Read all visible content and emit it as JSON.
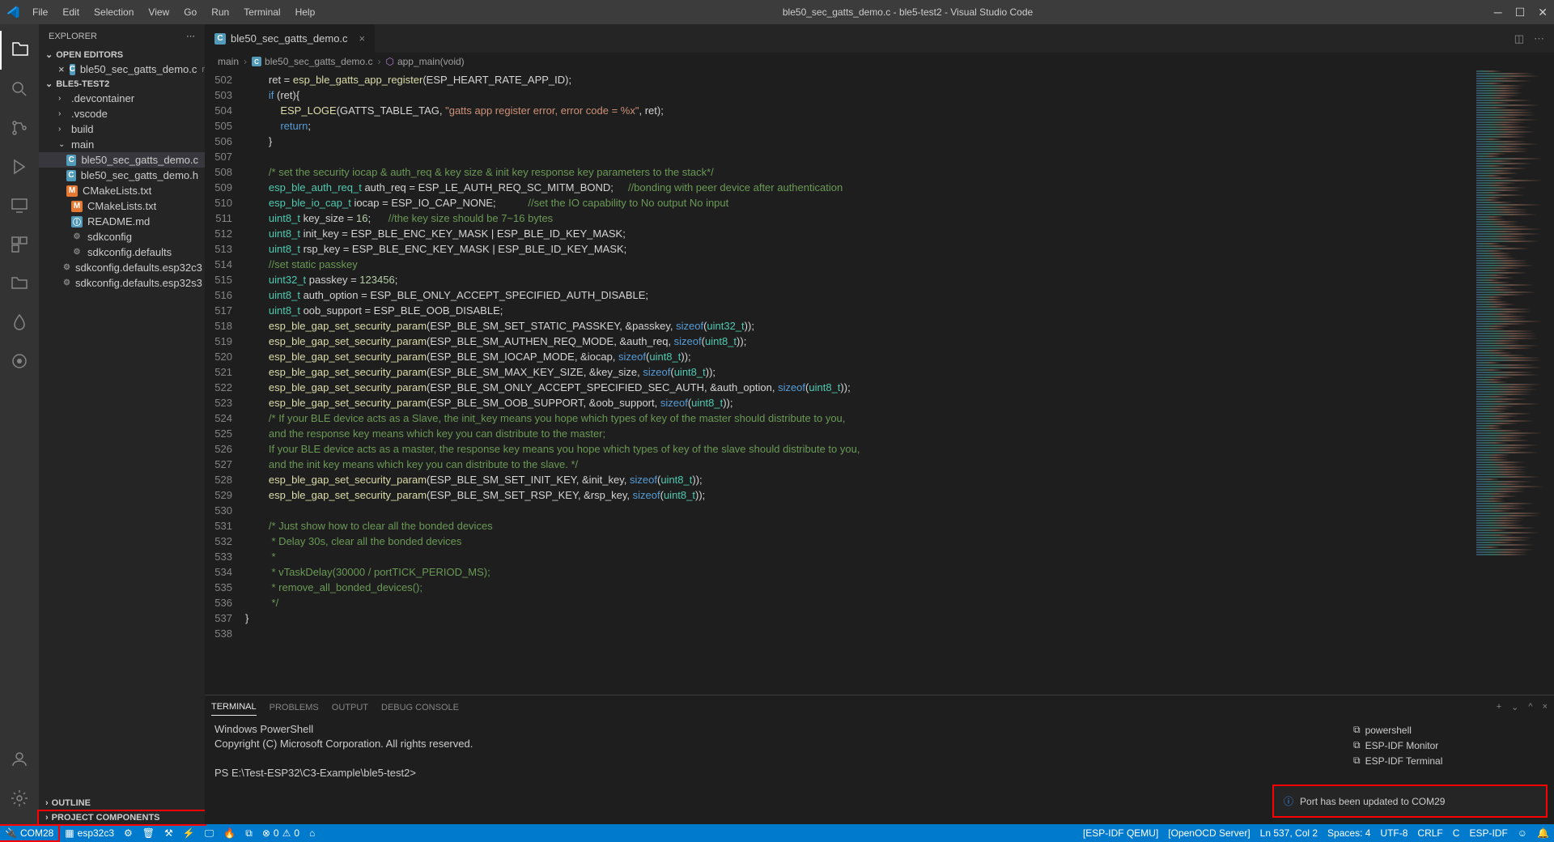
{
  "window": {
    "title": "ble50_sec_gatts_demo.c - ble5-test2 - Visual Studio Code"
  },
  "menu": [
    "File",
    "Edit",
    "Selection",
    "View",
    "Go",
    "Run",
    "Terminal",
    "Help"
  ],
  "explorer": {
    "title": "EXPLORER",
    "sections": {
      "open_editors": "OPEN EDITORS",
      "workspace": "BLE5-TEST2",
      "outline": "OUTLINE",
      "project_components": "PROJECT COMPONENTS"
    },
    "open_editor_file": "ble50_sec_gatts_demo.c",
    "open_editor_folder": "main",
    "tree": [
      {
        "name": ".devcontainer",
        "type": "folder"
      },
      {
        "name": ".vscode",
        "type": "folder"
      },
      {
        "name": "build",
        "type": "folder"
      },
      {
        "name": "main",
        "type": "folder",
        "expanded": true,
        "children": [
          {
            "name": "ble50_sec_gatts_demo.c",
            "type": "c",
            "selected": true
          },
          {
            "name": "ble50_sec_gatts_demo.h",
            "type": "c"
          },
          {
            "name": "CMakeLists.txt",
            "type": "m"
          }
        ]
      },
      {
        "name": "CMakeLists.txt",
        "type": "m"
      },
      {
        "name": "README.md",
        "type": "readme"
      },
      {
        "name": "sdkconfig",
        "type": "gear"
      },
      {
        "name": "sdkconfig.defaults",
        "type": "gear"
      },
      {
        "name": "sdkconfig.defaults.esp32c3",
        "type": "gear"
      },
      {
        "name": "sdkconfig.defaults.esp32s3",
        "type": "gear"
      }
    ]
  },
  "tab": {
    "filename": "ble50_sec_gatts_demo.c"
  },
  "breadcrumb": {
    "folder": "main",
    "file": "ble50_sec_gatts_demo.c",
    "symbol": "app_main(void)"
  },
  "code_lines": [
    {
      "n": 502,
      "html": "        ret = <span class='fn'>esp_ble_gatts_app_register</span>(ESP_HEART_RATE_APP_ID);"
    },
    {
      "n": 503,
      "html": "        <span class='kw'>if</span> (ret){"
    },
    {
      "n": 504,
      "html": "            <span class='fn'>ESP_LOGE</span>(GATTS_TABLE_TAG, <span class='str'>\"gatts app register error, error code = %x\"</span>, ret);"
    },
    {
      "n": 505,
      "html": "            <span class='kw'>return</span>;"
    },
    {
      "n": 506,
      "html": "        }"
    },
    {
      "n": 507,
      "html": ""
    },
    {
      "n": 508,
      "html": "        <span class='com'>/* set the security iocap & auth_req & key size & init key response key parameters to the stack*/</span>"
    },
    {
      "n": 509,
      "html": "        <span class='type'>esp_ble_auth_req_t</span> auth_req = ESP_LE_AUTH_REQ_SC_MITM_BOND;     <span class='com'>//bonding with peer device after authentication</span>"
    },
    {
      "n": 510,
      "html": "        <span class='type'>esp_ble_io_cap_t</span> iocap = ESP_IO_CAP_NONE;           <span class='com'>//set the IO capability to No output No input</span>"
    },
    {
      "n": 511,
      "html": "        <span class='type'>uint8_t</span> key_size = <span class='num'>16</span>;      <span class='com'>//the key size should be 7~16 bytes</span>"
    },
    {
      "n": 512,
      "html": "        <span class='type'>uint8_t</span> init_key = ESP_BLE_ENC_KEY_MASK | ESP_BLE_ID_KEY_MASK;"
    },
    {
      "n": 513,
      "html": "        <span class='type'>uint8_t</span> rsp_key = ESP_BLE_ENC_KEY_MASK | ESP_BLE_ID_KEY_MASK;"
    },
    {
      "n": 514,
      "html": "        <span class='com'>//set static passkey</span>"
    },
    {
      "n": 515,
      "html": "        <span class='type'>uint32_t</span> passkey = <span class='num'>123456</span>;"
    },
    {
      "n": 516,
      "html": "        <span class='type'>uint8_t</span> auth_option = ESP_BLE_ONLY_ACCEPT_SPECIFIED_AUTH_DISABLE;"
    },
    {
      "n": 517,
      "html": "        <span class='type'>uint8_t</span> oob_support = ESP_BLE_OOB_DISABLE;"
    },
    {
      "n": 518,
      "html": "        <span class='fn'>esp_ble_gap_set_security_param</span>(ESP_BLE_SM_SET_STATIC_PASSKEY, &passkey, <span class='kw'>sizeof</span>(<span class='type'>uint32_t</span>));"
    },
    {
      "n": 519,
      "html": "        <span class='fn'>esp_ble_gap_set_security_param</span>(ESP_BLE_SM_AUTHEN_REQ_MODE, &auth_req, <span class='kw'>sizeof</span>(<span class='type'>uint8_t</span>));"
    },
    {
      "n": 520,
      "html": "        <span class='fn'>esp_ble_gap_set_security_param</span>(ESP_BLE_SM_IOCAP_MODE, &iocap, <span class='kw'>sizeof</span>(<span class='type'>uint8_t</span>));"
    },
    {
      "n": 521,
      "html": "        <span class='fn'>esp_ble_gap_set_security_param</span>(ESP_BLE_SM_MAX_KEY_SIZE, &key_size, <span class='kw'>sizeof</span>(<span class='type'>uint8_t</span>));"
    },
    {
      "n": 522,
      "html": "        <span class='fn'>esp_ble_gap_set_security_param</span>(ESP_BLE_SM_ONLY_ACCEPT_SPECIFIED_SEC_AUTH, &auth_option, <span class='kw'>sizeof</span>(<span class='type'>uint8_t</span>));"
    },
    {
      "n": 523,
      "html": "        <span class='fn'>esp_ble_gap_set_security_param</span>(ESP_BLE_SM_OOB_SUPPORT, &oob_support, <span class='kw'>sizeof</span>(<span class='type'>uint8_t</span>));"
    },
    {
      "n": 524,
      "html": "        <span class='com'>/* If your BLE device acts as a Slave, the init_key means you hope which types of key of the master should distribute to you,</span>"
    },
    {
      "n": 525,
      "html": "<span class='com'>        and the response key means which key you can distribute to the master;</span>"
    },
    {
      "n": 526,
      "html": "<span class='com'>        If your BLE device acts as a master, the response key means you hope which types of key of the slave should distribute to you,</span>"
    },
    {
      "n": 527,
      "html": "<span class='com'>        and the init key means which key you can distribute to the slave. */</span>"
    },
    {
      "n": 528,
      "html": "        <span class='fn'>esp_ble_gap_set_security_param</span>(ESP_BLE_SM_SET_INIT_KEY, &init_key, <span class='kw'>sizeof</span>(<span class='type'>uint8_t</span>));"
    },
    {
      "n": 529,
      "html": "        <span class='fn'>esp_ble_gap_set_security_param</span>(ESP_BLE_SM_SET_RSP_KEY, &rsp_key, <span class='kw'>sizeof</span>(<span class='type'>uint8_t</span>));"
    },
    {
      "n": 530,
      "html": ""
    },
    {
      "n": 531,
      "html": "        <span class='com'>/* Just show how to clear all the bonded devices</span>"
    },
    {
      "n": 532,
      "html": "<span class='com'>         * Delay 30s, clear all the bonded devices</span>"
    },
    {
      "n": 533,
      "html": "<span class='com'>         *</span>"
    },
    {
      "n": 534,
      "html": "<span class='com'>         * vTaskDelay(30000 / portTICK_PERIOD_MS);</span>"
    },
    {
      "n": 535,
      "html": "<span class='com'>         * remove_all_bonded_devices();</span>"
    },
    {
      "n": 536,
      "html": "<span class='com'>         */</span>"
    },
    {
      "n": 537,
      "html": "}"
    },
    {
      "n": 538,
      "html": ""
    }
  ],
  "panel": {
    "tabs": [
      "TERMINAL",
      "PROBLEMS",
      "OUTPUT",
      "DEBUG CONSOLE"
    ],
    "active_tab": 0,
    "terminal_lines": [
      "Windows PowerShell",
      "Copyright (C) Microsoft Corporation. All rights reserved.",
      "",
      "PS E:\\Test-ESP32\\C3-Example\\ble5-test2> "
    ],
    "terminals": [
      "powershell",
      "ESP-IDF Monitor",
      "ESP-IDF Terminal"
    ]
  },
  "notification": {
    "message": "Port has been updated to COM29"
  },
  "statusbar": {
    "port": "COM28",
    "chip": "esp32c3",
    "diag": "0",
    "warn": "0",
    "right": [
      "[ESP-IDF QEMU]",
      "[OpenOCD Server]",
      "Ln 537, Col 2",
      "Spaces: 4",
      "UTF-8",
      "CRLF",
      "C",
      "ESP-IDF"
    ]
  }
}
